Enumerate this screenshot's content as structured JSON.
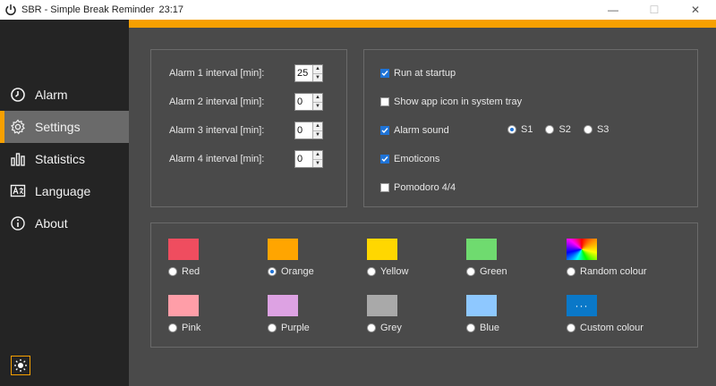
{
  "window": {
    "app_abbr": "SBR",
    "app_name": "Simple Break Reminder",
    "separator": "-",
    "time": "23:17",
    "minimize": "—",
    "maximize": "☐",
    "close": "✕"
  },
  "sidebar": {
    "items": [
      {
        "label": "Alarm",
        "icon": "alarm-clock-icon",
        "active": false
      },
      {
        "label": "Settings",
        "icon": "gear-icon",
        "active": true
      },
      {
        "label": "Statistics",
        "icon": "bar-chart-icon",
        "active": false
      },
      {
        "label": "Language",
        "icon": "language-icon",
        "active": false
      },
      {
        "label": "About",
        "icon": "info-icon",
        "active": false
      }
    ],
    "theme_icon": "sun-icon"
  },
  "colors": {
    "accent": "#f7a000",
    "sidebar": "#242424",
    "background": "#4a4a4a",
    "check_blue": "#1f73d6"
  },
  "intervals": [
    {
      "label": "Alarm 1 interval [min]:",
      "value": "25"
    },
    {
      "label": "Alarm 2 interval [min]:",
      "value": "0"
    },
    {
      "label": "Alarm 3 interval [min]:",
      "value": "0"
    },
    {
      "label": "Alarm 4 interval [min]:",
      "value": "0"
    }
  ],
  "options": {
    "run_at_startup": {
      "label": "Run at startup",
      "checked": true
    },
    "show_tray_icon": {
      "label": "Show app icon in system tray",
      "checked": false
    },
    "alarm_sound": {
      "label": "Alarm sound",
      "checked": true
    },
    "emoticons": {
      "label": "Emoticons",
      "checked": true
    },
    "pomodoro": {
      "label": "Pomodoro 4/4",
      "checked": false
    },
    "sounds": [
      {
        "label": "S1",
        "selected": true
      },
      {
        "label": "S2",
        "selected": false
      },
      {
        "label": "S3",
        "selected": false
      }
    ]
  },
  "colours": [
    {
      "label": "Red",
      "color": "#ef4d5f",
      "selected": false
    },
    {
      "label": "Orange",
      "color": "#ffa500",
      "selected": true
    },
    {
      "label": "Yellow",
      "color": "#ffd700",
      "selected": false
    },
    {
      "label": "Green",
      "color": "#6fdb6f",
      "selected": false
    },
    {
      "label": "Random colour",
      "color": "rainbow",
      "selected": false
    },
    {
      "label": "Pink",
      "color": "#ff9ea8",
      "selected": false
    },
    {
      "label": "Purple",
      "color": "#dda2e3",
      "selected": false
    },
    {
      "label": "Grey",
      "color": "#a9a9a9",
      "selected": false
    },
    {
      "label": "Blue",
      "color": "#8ec8ff",
      "selected": false
    },
    {
      "label": "Custom colour",
      "color": "#0a78c8",
      "selected": false,
      "swatch_text": "···"
    }
  ]
}
